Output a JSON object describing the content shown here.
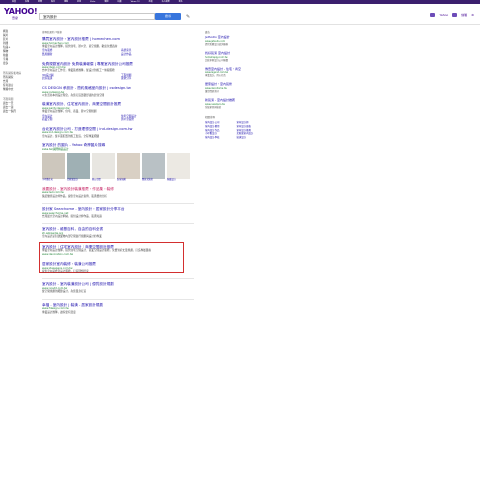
{
  "topnav": [
    "首頁",
    "信箱",
    "新聞",
    "股市",
    "運動",
    "氣象",
    "Flickr",
    "購物",
    "拍賣",
    "Yahoo TV",
    "旅遊",
    "名人娛樂",
    "更多"
  ],
  "logo": {
    "text": "YAHOO!",
    "sub": "奇摩"
  },
  "search": {
    "query": "室內設計",
    "button": "搜尋"
  },
  "header_right": {
    "user": "Yahoo",
    "mail": "信箱"
  },
  "leftnav": {
    "items": [
      "網頁",
      "圖片",
      "影片",
      "新聞",
      "知識+",
      "購物",
      "拍賣",
      "字典",
      "更多"
    ],
    "sect1": "所有國家和地區",
    "sect1_items": [
      "所有國家",
      "台灣",
      "任何語言",
      "繁體中文"
    ],
    "sect2": "不限時間",
    "sect2_items": [
      "過去一天",
      "過去一週",
      "過去一個月"
    ]
  },
  "meta": "搜尋結果約 3億筆",
  "results": [
    {
      "title": "購買室內設計・室內設計推薦 | homechen.com",
      "url": "www.homechen.com",
      "desc": "專業室內設計團隊，提供住宅、辦公室、商空規劃，歡迎免費諮詢",
      "sub": [
        "室內裝修",
        "系統家具",
        "舊屋翻新",
        "設計作品"
      ]
    },
    {
      "title": "免費規劃室內設計 免費裝潢報價 | 專業室內設計公司推薦",
      "url": "www.dsgn.com.tw",
      "desc": "台中室內設計工作室，專業裝修團隊，從設計到施工一條龍服務",
      "sub": [
        "3D設計圖",
        "工程規劃",
        "居家裝潢",
        "案例分享"
      ]
    },
    {
      "title": "CS DESIGN 承設計 - 簡約風格室內設計 | csdesign.tw",
      "url": "www.csdesign.tw",
      "desc": "以生活為本的設計理念，為您打造溫馨舒適的居住空間",
      "sub": []
    },
    {
      "title": "裝潢室內設計、住宅室內設計、商業空間設計推薦",
      "url": "www.parity.design.tw",
      "desc": "專業室內設計團隊，住宅、商業、辦公空間規劃",
      "sub": [
        "室內設計",
        "住宅空間設計",
        "商業空間",
        "辦公室裝修"
      ]
    },
    {
      "title": "台北室內設計公司 - 打造理想空間 | ind-design.com.tw",
      "url": "www.ind-design.com.tw",
      "desc": "室內設計，從平面配置到施工監造，全程專業把關",
      "sub": []
    }
  ],
  "images": {
    "header": "室內設計 的圖片 - Yahoo 奇摩圖片搜尋",
    "url": "zaba.tw/國際精品設計",
    "captions": [
      "小坪數住宅",
      "北歐風設計",
      "辦公空間",
      "臥室規劃",
      "開放式廚房",
      "客廳設計"
    ]
  },
  "results2": [
    {
      "title": "我要設計 - 室內設計裝潢推薦・作品集・裝修",
      "url": "www.iwd.com.tw",
      "desc": "集結優秀設計師作品，提供室內設計案例、裝潢費用分析"
    },
    {
      "title": "設計家 Searchome - 室內設計・居家設計分享平台",
      "url": "www.searchome.net",
      "desc": "台灣最大室內設計網站，提供設計師作品、裝潢知識"
    },
    {
      "title": "室內設計 - 維基百科，自由的百科全書",
      "url": "zh.wikipedia.org",
      "desc": "室內設計是對建築物內部空間進行規劃與設計的專業"
    }
  ],
  "highlighted": {
    "title": "室內設計｜住宅室內設計｜商業空間設計推薦",
    "url": "www.decoration.com.tw",
    "desc": "專業室內設計團隊，提供住宅空間設計、商業空間設計服務，免費到府丈量規劃，打造專屬風格"
  },
  "results3": [
    {
      "title": "居家設計室內裝修・裝潢公司推薦",
      "url": "www.ideaspace.com.tw",
      "desc": "提供室內裝修及設計服務，打造理想居家"
    },
    {
      "title": "室內設計 - 室內裝潢設計公司 | 優質設計規劃",
      "url": "www.nnsdd.com.tw",
      "desc": "從空間規劃到細節設計，為您量身打造"
    },
    {
      "title": "幸福 - 室內設計 | 裝潢 - 居家設計規劃",
      "url": "www.fdesign.com.tw",
      "desc": "專業設計團隊，讓家更有溫度"
    }
  ],
  "right": {
    "label": "廣告",
    "ads": [
      {
        "title": "JetSoDo 室內設計",
        "url": "www.jetsodo.com",
        "desc": "提供免費設計諮詢服務"
      },
      {
        "title": "找好裝潢 室內設計",
        "url": "homehappy.com.tw",
        "desc": "比較多家設計公司報價"
      },
      {
        "title": "傳奇室內設計 - 住宅・商空",
        "url": "www.legend.com.tw",
        "desc": "專業設計，用心打造"
      },
      {
        "title": "居家設計・室內裝修",
        "url": "www.decohome.tw",
        "desc": "讓空間更美好"
      },
      {
        "title": "新裝潢 - 室內設計推薦",
        "url": "www.newdeco.tw",
        "desc": "系統家具與裝修"
      }
    ],
    "related_label": "相關搜尋",
    "related": [
      "室內設計公司",
      "室內設計師",
      "室內設計費用",
      "室內設計風格",
      "室內設計作品",
      "室內設計推薦",
      "小坪數設計",
      "北歐風室內設計",
      "室內設計學校",
      "裝潢設計"
    ]
  }
}
